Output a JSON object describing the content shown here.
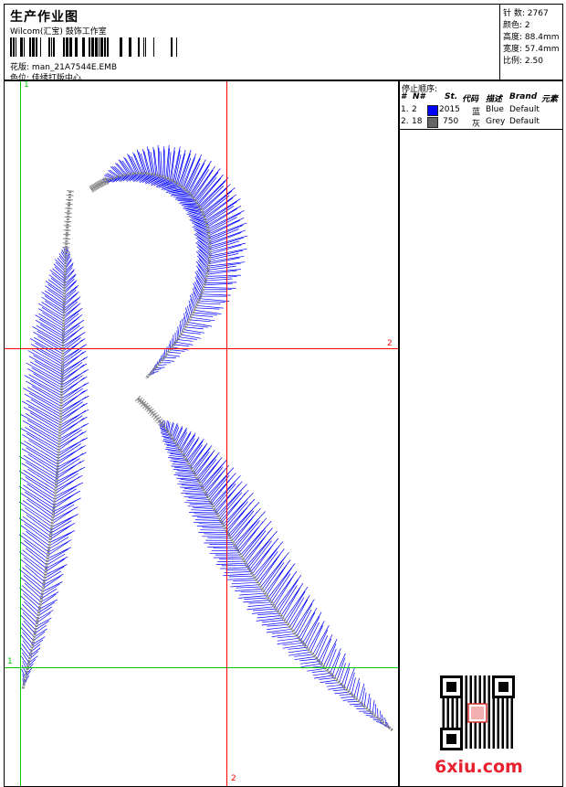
{
  "header": {
    "title": "生产作业图",
    "company": "Wilcom(汇宝) 鼓饰工作室",
    "design_label": "花版:",
    "design_file": "man_21A7544E.EMB",
    "colorway_label": "色位:",
    "colorway": "佳绣打版中心"
  },
  "stats": [
    {
      "label": "针 数:",
      "value": "2767"
    },
    {
      "label": "颜色:",
      "value": "2"
    },
    {
      "label": "高度:",
      "value": "88.4mm"
    },
    {
      "label": "宽度:",
      "value": "57.4mm"
    },
    {
      "label": "比例:",
      "value": "2.50"
    }
  ],
  "legend": {
    "title": "停止顺序:",
    "headers": [
      "#",
      "N#",
      "St.",
      "代码",
      "描述",
      "Brand",
      "元素"
    ],
    "rows": [
      {
        "idx": "1.",
        "n": "2",
        "color": "#0000ff",
        "st": "2015",
        "code": "蓝",
        "desc": "Blue",
        "brand": "Default"
      },
      {
        "idx": "2.",
        "n": "18",
        "color": "#666666",
        "st": "750",
        "code": "灰",
        "desc": "Grey",
        "brand": "Default"
      }
    ]
  },
  "guides": {
    "green_label_top": "1",
    "green_label_left": "1",
    "red_label_right": "2",
    "red_label_bottom": "2",
    "green": "#00cc00",
    "red": "#ff0000"
  },
  "colors": {
    "thread_blue": "#0000ff",
    "thread_grey": "#888888"
  },
  "watermark": "6xiu.com"
}
